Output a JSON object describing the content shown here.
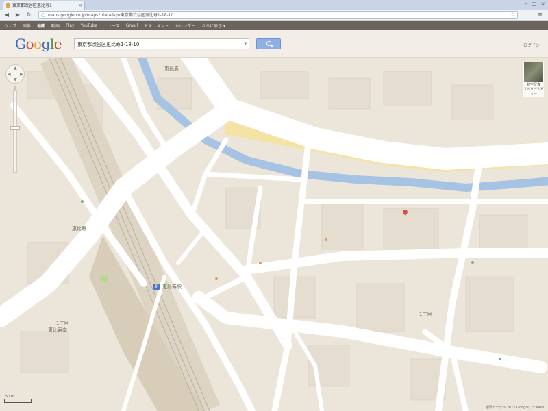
{
  "browser": {
    "tab_title": "東京都渋谷区恵比寿1",
    "tab_close": "×",
    "url": "maps.google.co.jp/maps?hl=ja&q=東京都渋谷区恵比寿1-18-10",
    "window_controls": [
      "–",
      "□",
      "×"
    ],
    "nav": {
      "back": "◀",
      "forward": "▶",
      "reload": "↻"
    }
  },
  "gbar": {
    "links": [
      "ウェブ",
      "画像",
      "地図",
      "動画",
      "Play",
      "YouTube",
      "ニュース",
      "Gmail",
      "ドキュメント",
      "カレンダー",
      "さらに表示 ▾"
    ],
    "active_index": 2
  },
  "header": {
    "logo": [
      "G",
      "o",
      "o",
      "g",
      "l",
      "e"
    ],
    "search_value": "東京都渋谷区恵比寿1-18-10",
    "search_dropdown": "▾",
    "user_link": "ログイン"
  },
  "map": {
    "labels": [
      {
        "text": "1丁目",
        "name": "district-label"
      },
      {
        "text": "恵比寿南",
        "name": "district-label"
      },
      {
        "text": "恵比寿",
        "name": "district-label"
      },
      {
        "text": "1丁目",
        "name": "district-label"
      },
      {
        "text": "恵比寿駅",
        "name": "station-label"
      },
      {
        "text": "恵比寿",
        "name": "district-label"
      }
    ],
    "satellite_label": "航空写真",
    "streetview_label": "ストリートビュー",
    "scale_text": "50 m",
    "copyright": "地図データ ©2012 Google, ZENRIN",
    "station_icon": "駅",
    "colors": {
      "road": "#ffffff",
      "river": "#a7c3e4",
      "yellow_road": "#f4e3a4",
      "background": "#ece6da",
      "block": "#e3dccf"
    }
  }
}
